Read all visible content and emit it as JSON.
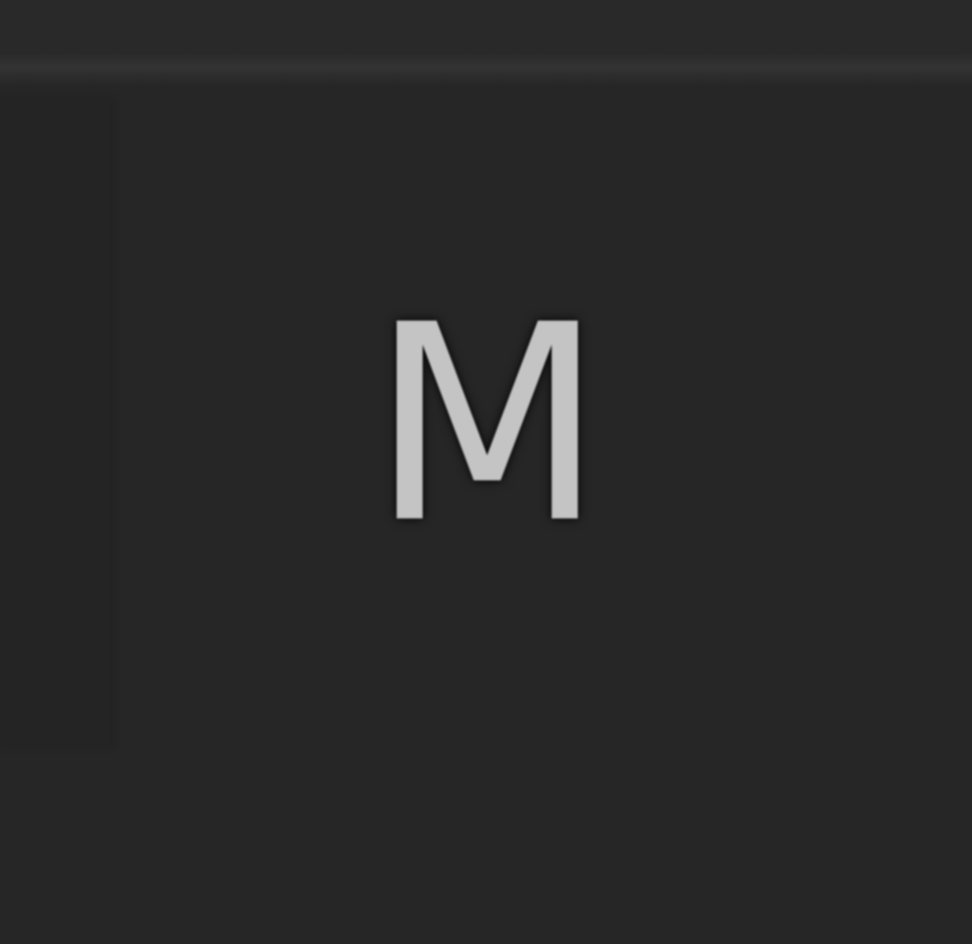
{
  "app": {
    "badge_letter": "M"
  },
  "colors": {
    "background": "#262626",
    "top_bar": "#292929",
    "divider": "#333333",
    "side_panel": "#242424",
    "letter": "#c4c4c4"
  }
}
